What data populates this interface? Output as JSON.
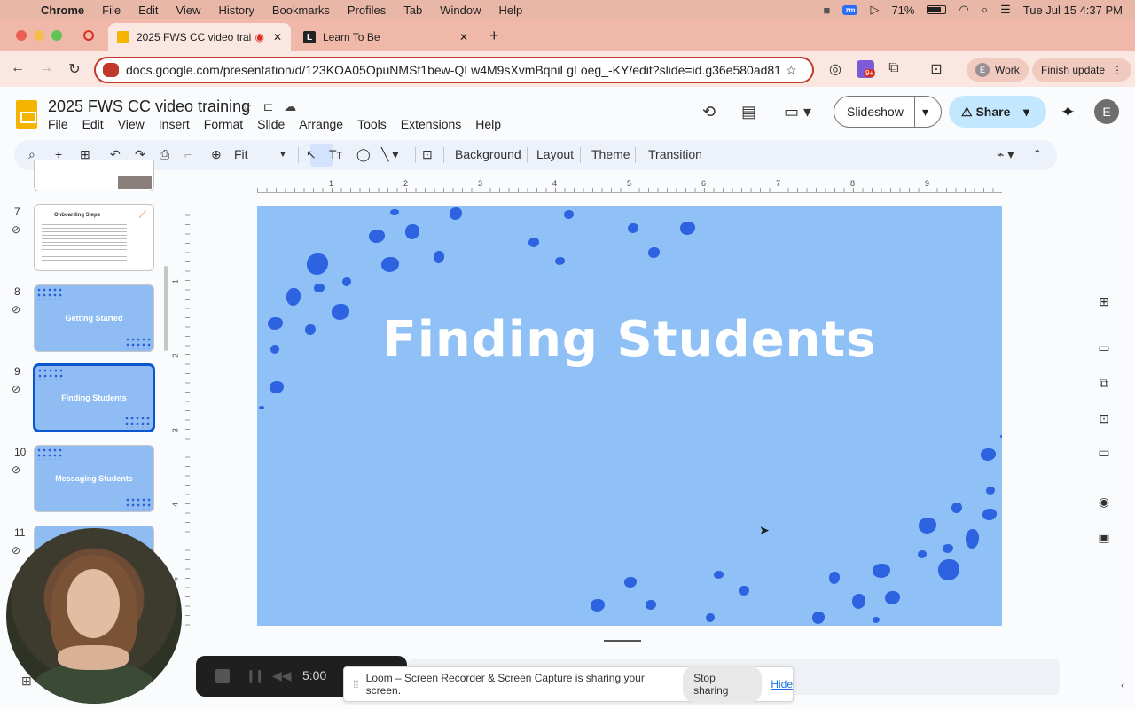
{
  "menubar": {
    "app": "Chrome",
    "items": [
      "File",
      "Edit",
      "View",
      "History",
      "Bookmarks",
      "Profiles",
      "Tab",
      "Window",
      "Help"
    ],
    "zoom_badge": "zm",
    "battery": "71%",
    "clock": "Tue Jul 15  4:37 PM"
  },
  "tabs": [
    {
      "title": "2025 FWS CC video traini"
    },
    {
      "title": "Learn To Be",
      "favicon_letter": "L"
    }
  ],
  "browser": {
    "url": "docs.google.com/presentation/d/123KOA05OpuNMSf1bew-QLw4M9sXvmBqniLgLoeg_-KY/edit?slide=id.g36e580ad81a_0_...",
    "ext_badge": "9+",
    "profile_initial": "E",
    "profile_label": "Work",
    "update_label": "Finish update"
  },
  "doc": {
    "title": "2025 FWS CC video training",
    "menu": [
      "File",
      "Edit",
      "View",
      "Insert",
      "Format",
      "Slide",
      "Arrange",
      "Tools",
      "Extensions",
      "Help"
    ],
    "slideshow_label": "Slideshow",
    "share_label": "Share",
    "account_initial": "E"
  },
  "slides_toolbar": {
    "zoom": "Fit",
    "background": "Background",
    "layout": "Layout",
    "theme": "Theme",
    "transition": "Transition"
  },
  "filmstrip": [
    {
      "num": "7",
      "title": "Onboarding Steps"
    },
    {
      "num": "8",
      "title": "Getting Started"
    },
    {
      "num": "9",
      "title": "Finding Students",
      "selected": true
    },
    {
      "num": "10",
      "title": "Messaging Students"
    },
    {
      "num": "11",
      "title": ""
    }
  ],
  "ruler": {
    "top": [
      "1",
      "2",
      "3",
      "4",
      "5",
      "6",
      "7",
      "8",
      "9"
    ],
    "left": [
      "1",
      "2",
      "3",
      "4",
      "5"
    ]
  },
  "slide": {
    "title": "Finding Students",
    "bg_color": "#8fc1f6",
    "accent_color": "#2d62e0"
  },
  "loom": {
    "timer": "5:00",
    "message": "Loom – Screen Recorder & Screen Capture is sharing your screen.",
    "stop_label": "Stop sharing",
    "hide_label": "Hide"
  }
}
